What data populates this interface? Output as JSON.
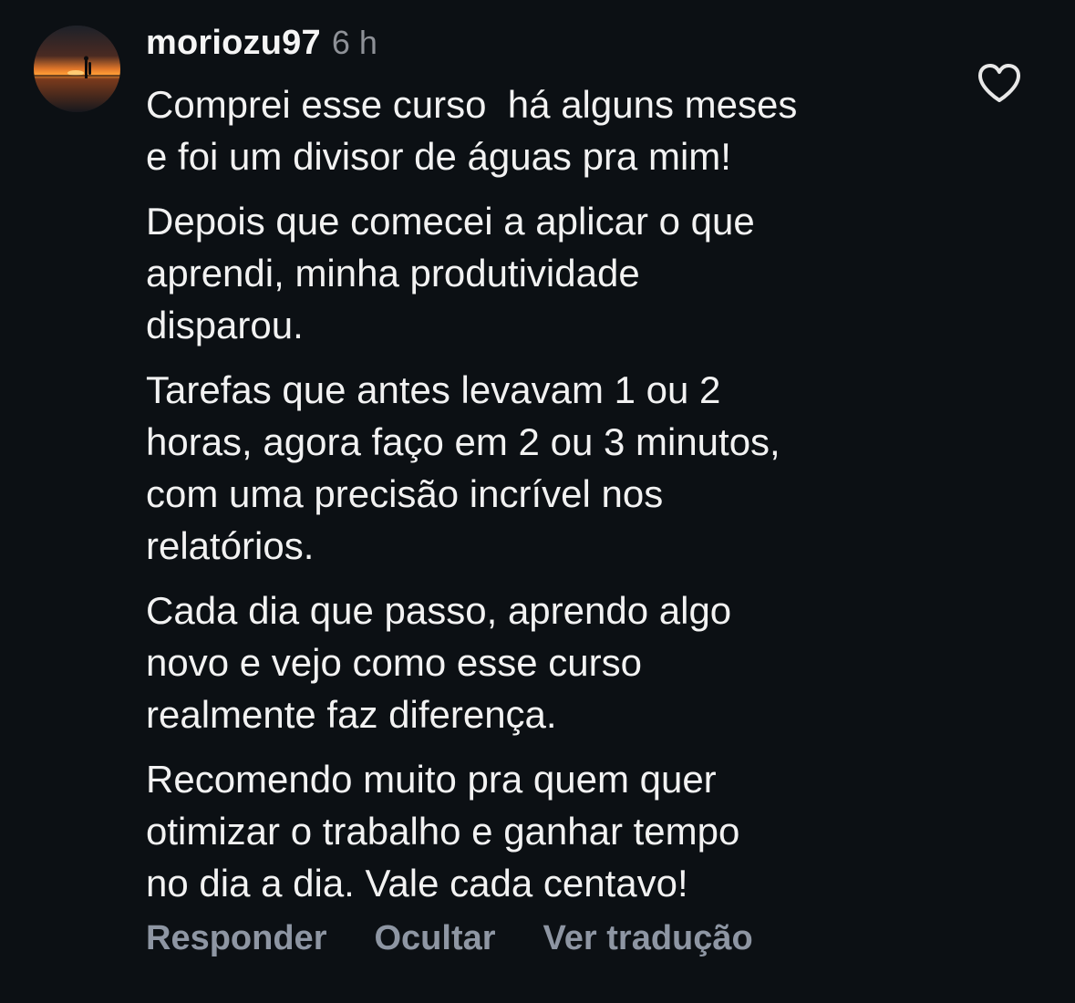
{
  "comment": {
    "username": "moriozu97",
    "time": "6 h",
    "avatar_icon": "sunset-surfer-avatar",
    "like_icon": "heart-icon",
    "paragraphs": [
      "Comprei esse curso  há alguns meses\ne foi um divisor de águas pra mim!",
      "Depois que comecei a aplicar o que\naprendi, minha produtividade\ndisparou.",
      "Tarefas que antes levavam 1 ou 2\nhoras, agora faço em 2 ou 3 minutos,\ncom uma precisão incrível nos\nrelatórios.",
      "Cada dia que passo, aprendo algo\nnovo e vejo como esse curso\nrealmente faz diferença.",
      "Recomendo muito pra quem quer\notimizar o trabalho e ganhar tempo\nno dia a dia. Vale cada centavo!"
    ],
    "actions": {
      "reply": "Responder",
      "hide": "Ocultar",
      "translate": "Ver tradução"
    }
  },
  "colors": {
    "background": "#0c1014",
    "text": "#f5f5f5",
    "muted": "#8e9197",
    "action": "#8e96a3"
  }
}
